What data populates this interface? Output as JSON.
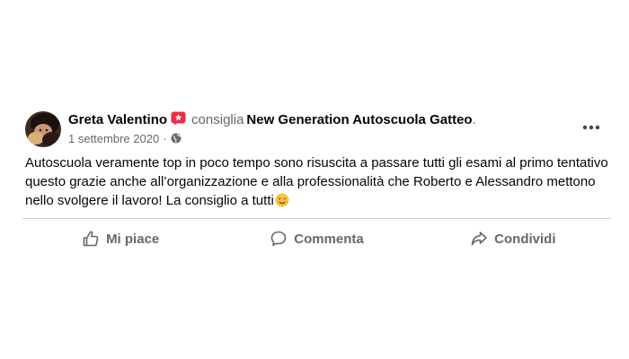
{
  "post": {
    "author": "Greta Valentino",
    "verb": "consiglia",
    "page_name": "New Generation Autoscuola Gatteo",
    "trailing_dot": ".",
    "date": "1 settembre 2020",
    "separator": "·",
    "audience_icon": "globe-icon",
    "badge_icon": "recommendation-star-icon",
    "text": "Autoscuola veramente top in poco tempo sono risuscita a passare tutti gli esami al primo tentativo questo grazie anche all’organizzazione e alla professionalità che Roberto e Alessandro mettono nello svolgere il lavoro! La consiglio a tutti",
    "emoji": "smiling-face-emoji",
    "more_icon": "more-dots-icon"
  },
  "actions": [
    {
      "label": "Mi piace",
      "icon": "thumbs-up-icon"
    },
    {
      "label": "Commenta",
      "icon": "comment-icon"
    },
    {
      "label": "Condividi",
      "icon": "share-icon"
    }
  ],
  "colors": {
    "text": "#050505",
    "secondary": "#65676b",
    "badge": "#f02849",
    "divider": "#ced0d4"
  }
}
